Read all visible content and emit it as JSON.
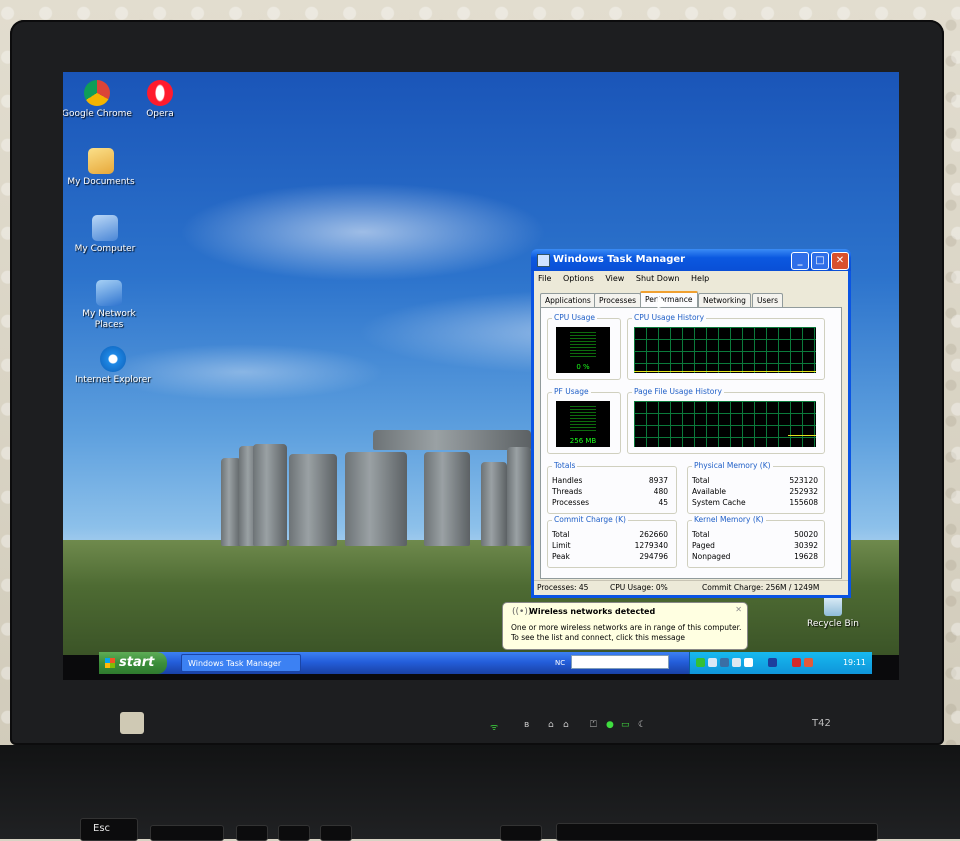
{
  "desktop": {
    "icons": [
      {
        "id": "chrome",
        "label": "Google Chrome",
        "color": "#db4437"
      },
      {
        "id": "opera",
        "label": "Opera",
        "color": "#ff1b2d"
      },
      {
        "id": "mydocs",
        "label": "My Documents",
        "color": "#f2c94c"
      },
      {
        "id": "mycomp",
        "label": "My Computer",
        "color": "#6fa7e8"
      },
      {
        "id": "network",
        "label": "My Network Places",
        "color": "#5a9be6"
      },
      {
        "id": "ie",
        "label": "Internet Explorer",
        "color": "#1e88e5"
      },
      {
        "id": "recycle",
        "label": "Recycle Bin",
        "color": "#9ec9e6"
      }
    ]
  },
  "taskmanager": {
    "title": "Windows Task Manager",
    "menu": [
      "File",
      "Options",
      "View",
      "Shut Down",
      "Help"
    ],
    "tabs": [
      "Applications",
      "Processes",
      "Performance",
      "Networking",
      "Users"
    ],
    "active_tab": "Performance",
    "groups": {
      "cpu_usage": "CPU Usage",
      "cpu_history": "CPU Usage History",
      "pf_usage": "PF Usage",
      "pf_history": "Page File Usage History",
      "totals": "Totals",
      "physical": "Physical Memory (K)",
      "commit": "Commit Charge (K)",
      "kernel": "Kernel Memory (K)"
    },
    "cpu_value": "0 %",
    "pf_value": "256 MB",
    "totals": [
      {
        "label": "Handles",
        "value": "8937"
      },
      {
        "label": "Threads",
        "value": "480"
      },
      {
        "label": "Processes",
        "value": "45"
      }
    ],
    "physical": [
      {
        "label": "Total",
        "value": "523120"
      },
      {
        "label": "Available",
        "value": "252932"
      },
      {
        "label": "System Cache",
        "value": "155608"
      }
    ],
    "commit": [
      {
        "label": "Total",
        "value": "262660"
      },
      {
        "label": "Limit",
        "value": "1279340"
      },
      {
        "label": "Peak",
        "value": "294796"
      }
    ],
    "kernel": [
      {
        "label": "Total",
        "value": "50020"
      },
      {
        "label": "Paged",
        "value": "30392"
      },
      {
        "label": "Nonpaged",
        "value": "19628"
      }
    ],
    "status": {
      "processes": "Processes: 45",
      "cpu": "CPU Usage: 0%",
      "commit": "Commit Charge: 256M / 1249M"
    }
  },
  "balloon": {
    "title": "Wireless networks detected",
    "line1": "One or more wireless networks are in range of this computer.",
    "line2": "To see the list and connect, click this message"
  },
  "taskbar": {
    "start_label": "start",
    "task_label": "Windows Task Manager",
    "toolbar_label": "NC",
    "clock": "19:11"
  },
  "laptop": {
    "model": "T42",
    "esc_label": "Esc"
  },
  "colors": {
    "xp_blue": "#0a54e3",
    "start_green": "#3c8f3b",
    "meter_green": "#1cff1c",
    "balloon_bg": "#ffffe1"
  }
}
